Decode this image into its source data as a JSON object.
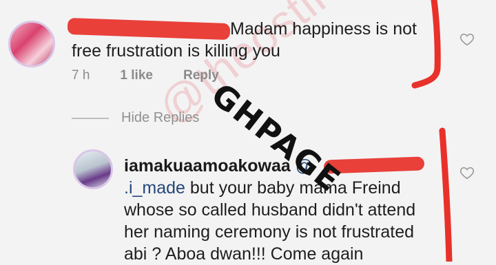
{
  "watermark_text": "@theostin",
  "stamp_text": "GHPAGE",
  "comment": {
    "text": "Madam happiness is not free frustration is killing you",
    "time": "7 h",
    "likes": "1 like",
    "reply_label": "Reply"
  },
  "hide_replies_label": "Hide Replies",
  "reply": {
    "username": "iamakuaamoakowaa",
    "mention": "@",
    "mention_tail": ".i_made",
    "text": "but your baby mama Freind whose so called husband didn't attend her naming ceremony is not frustrated abi ? Aboa dwan!!! Come again"
  },
  "icons": {
    "like": "heart-outline-icon",
    "avatar": "profile-photo"
  },
  "colors": {
    "redaction": "#e8312a",
    "mention": "#25477a",
    "meta": "#8a8a8a"
  }
}
